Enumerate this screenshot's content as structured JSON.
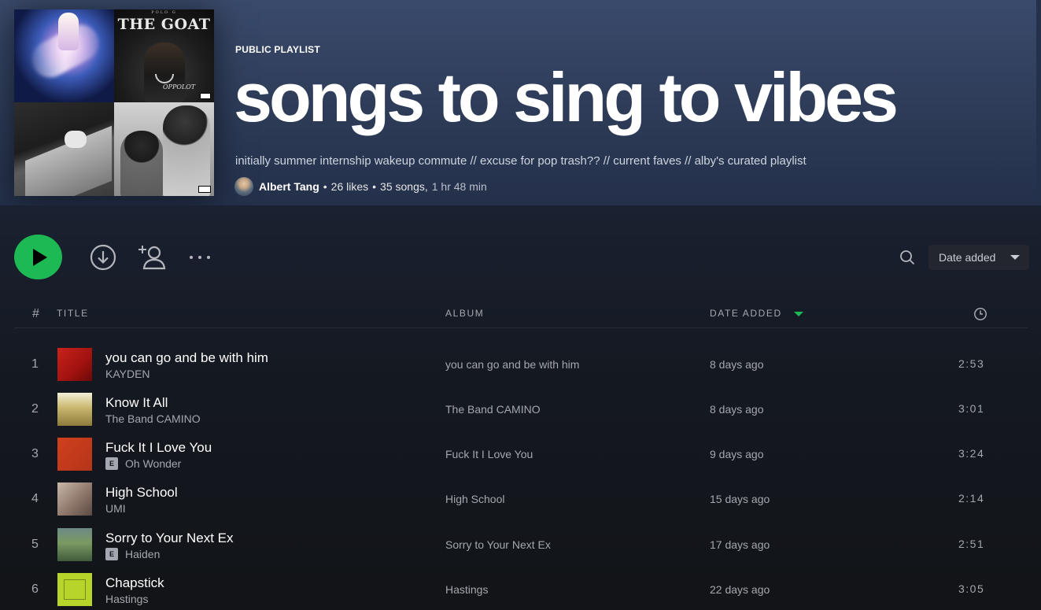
{
  "playlist": {
    "kind": "PUBLIC PLAYLIST",
    "title": "songs to sing to vibes",
    "description": "initially summer internship wakeup commute // excuse for pop trash?? // current faves // alby's curated playlist",
    "owner": "Albert Tang",
    "likes": "26 likes",
    "songs": "35 songs,",
    "duration": "1 hr 48 min",
    "cover_text": {
      "tile2_title": "THE GOAT",
      "tile2_sub": "POLO G",
      "tile2_caption": "OPPOLOT"
    }
  },
  "controls": {
    "play_icon": "play-icon",
    "download_icon": "download-icon",
    "follow_icon": "add-user-icon",
    "more_icon": "more-dots-icon",
    "search_icon": "search-icon",
    "sort_label": "Date added"
  },
  "table": {
    "headers": {
      "num": "#",
      "title": "TITLE",
      "album": "ALBUM",
      "date_added": "DATE ADDED",
      "duration_icon": "clock-icon"
    },
    "rows": [
      {
        "index": "1",
        "title": "you can go and be with him",
        "artist": "KAYDEN",
        "explicit": false,
        "album": "you can go and be with him",
        "added": "8 days ago",
        "length": "2:53"
      },
      {
        "index": "2",
        "title": "Know It All",
        "artist": "The Band CAMINO",
        "explicit": false,
        "album": "The Band CAMINO",
        "added": "8 days ago",
        "length": "3:01"
      },
      {
        "index": "3",
        "title": "Fuck It I Love You",
        "artist": "Oh Wonder",
        "explicit": true,
        "explicit_label": "E",
        "album": "Fuck It I Love You",
        "added": "9 days ago",
        "length": "3:24"
      },
      {
        "index": "4",
        "title": "High School",
        "artist": "UMI",
        "explicit": false,
        "album": "High School",
        "added": "15 days ago",
        "length": "2:14"
      },
      {
        "index": "5",
        "title": "Sorry to Your Next Ex",
        "artist": "Haiden",
        "explicit": true,
        "explicit_label": "E",
        "album": "Sorry to Your Next Ex",
        "added": "17 days ago",
        "length": "2:51"
      },
      {
        "index": "6",
        "title": "Chapstick",
        "artist": "Hastings",
        "explicit": false,
        "album": "Hastings",
        "added": "22 days ago",
        "length": "3:05"
      }
    ]
  },
  "colors": {
    "accent": "#1db954",
    "header_bg": "#3a4a6b",
    "page_bg": "#121417",
    "muted_text": "#a4a7af"
  }
}
